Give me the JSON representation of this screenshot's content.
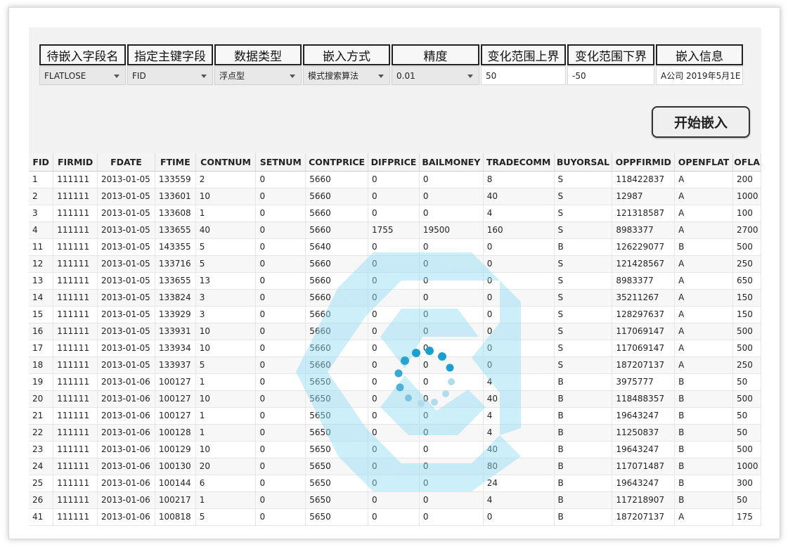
{
  "config": {
    "headers": [
      "待嵌入字段名",
      "指定主键字段",
      "数据类型",
      "嵌入方式",
      "精度",
      "变化范围上界",
      "变化范围下界",
      "嵌入信息"
    ],
    "field_select": "FLATLOSE",
    "key_select": "FID",
    "type_select": "浮点型",
    "method_select": "模式搜索算法",
    "precision_select": "0.01",
    "upper_bound": "50",
    "lower_bound": "-50",
    "embed_info": "A公司 2019年5月1E"
  },
  "start_button": "开始嵌入",
  "table": {
    "columns": [
      "FID",
      "FIRMID",
      "FDATE",
      "FTIME",
      "CONTNUM",
      "SETNUM",
      "CONTPRICE",
      "DIFPRICE",
      "BAILMONEY",
      "TRADECOMM",
      "BUYORSAL",
      "OPPFIRMID",
      "OPENFLAT",
      "OFLA"
    ],
    "rows": [
      [
        "1",
        "111111",
        "2013-01-05",
        "133559",
        "2",
        "0",
        "5660",
        "0",
        "0",
        "8",
        "S",
        "118422837",
        "A",
        "200"
      ],
      [
        "2",
        "111111",
        "2013-01-05",
        "133601",
        "10",
        "0",
        "5660",
        "0",
        "0",
        "40",
        "S",
        "12987",
        "A",
        "1000"
      ],
      [
        "3",
        "111111",
        "2013-01-05",
        "133608",
        "1",
        "0",
        "5660",
        "0",
        "0",
        "4",
        "S",
        "121318587",
        "A",
        "100"
      ],
      [
        "4",
        "111111",
        "2013-01-05",
        "133655",
        "40",
        "0",
        "5660",
        "1755",
        "19500",
        "160",
        "S",
        "8983377",
        "A",
        "2700"
      ],
      [
        "11",
        "111111",
        "2013-01-05",
        "143355",
        "5",
        "0",
        "5640",
        "0",
        "0",
        "0",
        "B",
        "126229077",
        "B",
        "500"
      ],
      [
        "12",
        "111111",
        "2013-01-05",
        "133716",
        "5",
        "0",
        "5660",
        "0",
        "0",
        "0",
        "S",
        "121428567",
        "A",
        "250"
      ],
      [
        "13",
        "111111",
        "2013-01-05",
        "133655",
        "13",
        "0",
        "5660",
        "0",
        "0",
        "0",
        "S",
        "8983377",
        "A",
        "650"
      ],
      [
        "14",
        "111111",
        "2013-01-05",
        "133824",
        "3",
        "0",
        "5660",
        "0",
        "0",
        "0",
        "S",
        "35211267",
        "A",
        "150"
      ],
      [
        "15",
        "111111",
        "2013-01-05",
        "133929",
        "3",
        "0",
        "5660",
        "0",
        "0",
        "0",
        "S",
        "128297637",
        "A",
        "150"
      ],
      [
        "16",
        "111111",
        "2013-01-05",
        "133931",
        "10",
        "0",
        "5660",
        "0",
        "0",
        "0",
        "S",
        "117069147",
        "A",
        "500"
      ],
      [
        "17",
        "111111",
        "2013-01-05",
        "133934",
        "10",
        "0",
        "5660",
        "0",
        "0",
        "0",
        "S",
        "117069147",
        "A",
        "500"
      ],
      [
        "18",
        "111111",
        "2013-01-05",
        "133937",
        "5",
        "0",
        "5660",
        "0",
        "0",
        "0",
        "S",
        "187207137",
        "A",
        "250"
      ],
      [
        "19",
        "111111",
        "2013-01-06",
        "100127",
        "1",
        "0",
        "5650",
        "0",
        "0",
        "4",
        "B",
        "3975777",
        "B",
        "50"
      ],
      [
        "20",
        "111111",
        "2013-01-06",
        "100127",
        "10",
        "0",
        "5650",
        "0",
        "0",
        "40",
        "B",
        "118488357",
        "B",
        "500"
      ],
      [
        "21",
        "111111",
        "2013-01-06",
        "100127",
        "1",
        "0",
        "5650",
        "0",
        "0",
        "4",
        "B",
        "19643247",
        "B",
        "50"
      ],
      [
        "22",
        "111111",
        "2013-01-06",
        "100128",
        "1",
        "0",
        "5650",
        "0",
        "0",
        "4",
        "B",
        "11250837",
        "B",
        "50"
      ],
      [
        "23",
        "111111",
        "2013-01-06",
        "100129",
        "10",
        "0",
        "5650",
        "0",
        "0",
        "40",
        "B",
        "19643247",
        "B",
        "500"
      ],
      [
        "24",
        "111111",
        "2013-01-06",
        "100130",
        "20",
        "0",
        "5650",
        "0",
        "0",
        "80",
        "B",
        "117071487",
        "B",
        "1000"
      ],
      [
        "25",
        "111111",
        "2013-01-06",
        "100144",
        "6",
        "0",
        "5650",
        "0",
        "0",
        "24",
        "B",
        "19643247",
        "B",
        "300"
      ],
      [
        "26",
        "111111",
        "2013-01-06",
        "100217",
        "1",
        "0",
        "5650",
        "0",
        "0",
        "4",
        "B",
        "117218907",
        "B",
        "50"
      ],
      [
        "41",
        "111111",
        "2013-01-06",
        "100818",
        "5",
        "0",
        "5650",
        "0",
        "0",
        "0",
        "B",
        "187207137",
        "A",
        "175"
      ]
    ]
  },
  "colors": {
    "spinner": "#1a9fd0",
    "watermark": "#8fdcf5"
  },
  "icons": [
    "dropdown-caret-icon",
    "loading-spinner-icon",
    "watermark-logo-icon"
  ]
}
